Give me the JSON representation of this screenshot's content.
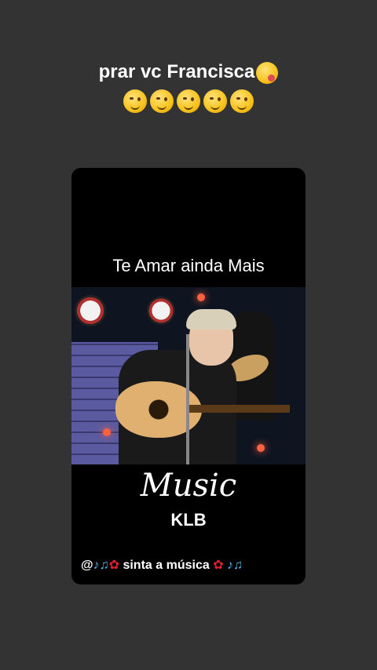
{
  "caption": {
    "line1": "prar vc Francisca",
    "emoji_line1": "yum-face-icon",
    "emoji_line2": [
      "wink-face-icon",
      "wink-face-icon",
      "wink-face-icon",
      "smirk-face-icon",
      "smirk-face-icon"
    ]
  },
  "card": {
    "song_title": "Te Amar ainda Mais",
    "music_word": "Music",
    "artist": "KLB",
    "footer": {
      "at": "@",
      "notes_icon": "musical-notes-icon",
      "rose_icon": "rose-icon",
      "text": " sinta a música "
    }
  },
  "colors": {
    "background": "#333333",
    "card": "#000000",
    "text": "#ffffff"
  }
}
